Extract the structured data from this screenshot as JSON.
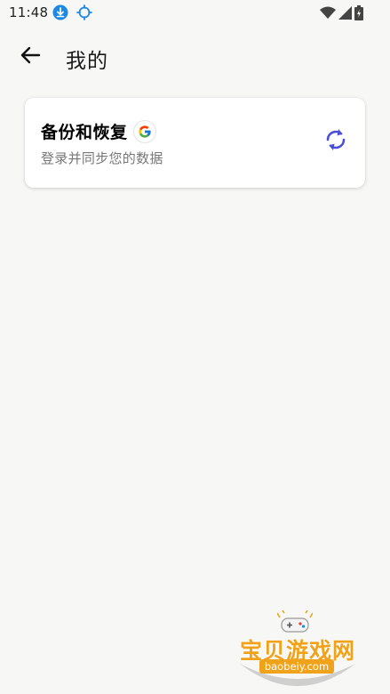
{
  "status_bar": {
    "time": "11:48",
    "left_icons": [
      "download-icon",
      "location-icon"
    ],
    "right_icons": [
      "wifi-icon",
      "signal-icon",
      "battery-charging-icon"
    ]
  },
  "app_bar": {
    "back_icon": "arrow-back-icon",
    "title": "我的"
  },
  "backup_card": {
    "title": "备份和恢复",
    "subtitle": "登录并同步您的数据",
    "badge_icon": "google-icon",
    "action_icon": "sync-icon",
    "accent_color": "#4a4fd6"
  },
  "watermark": {
    "text": "宝贝游戏网",
    "url": "baobeiy.com",
    "color": "#f0a21a"
  },
  "colors": {
    "background": "#f7f7f5",
    "card": "#ffffff",
    "status_accent": "#1e88e5"
  }
}
